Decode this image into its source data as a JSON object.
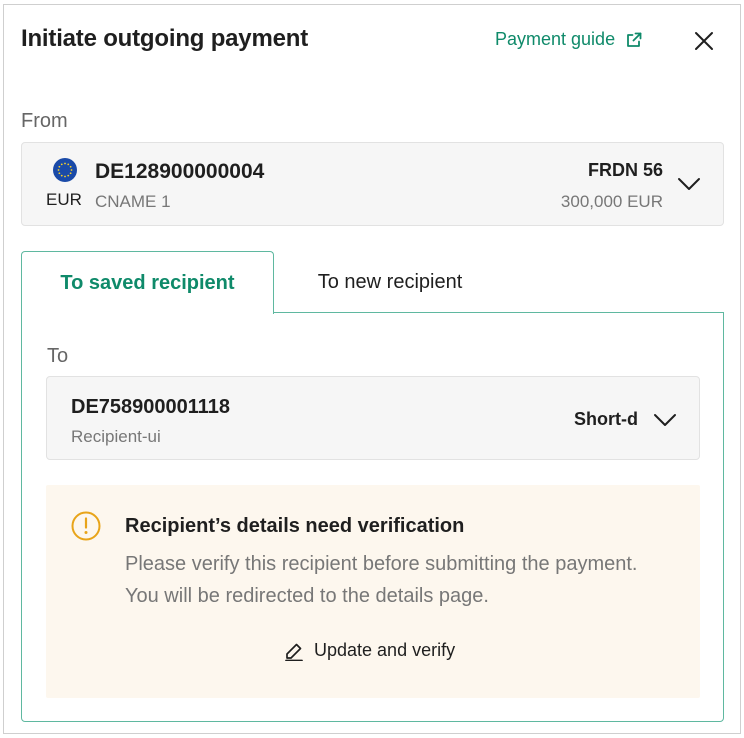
{
  "dialog": {
    "title": "Initiate outgoing payment",
    "guide_link": "Payment guide",
    "close_icon": "close-icon",
    "guide_icon": "external-link-icon"
  },
  "from": {
    "label": "From",
    "currency": "EUR",
    "flag_icon": "eu-flag-icon",
    "account_number": "DE128900000004",
    "account_name": "CNAME 1",
    "account_code": "FRDN 56",
    "balance": "300,000 EUR"
  },
  "tabs": [
    {
      "label": "To saved recipient",
      "active": true
    },
    {
      "label": "To new recipient",
      "active": false
    }
  ],
  "to": {
    "label": "To",
    "account_number": "DE758900001118",
    "recipient_name": "Recipient-ui",
    "reference": "Short-d"
  },
  "notice": {
    "icon": "warning-icon",
    "title": "Recipient’s details need verification",
    "line1": "Please verify this recipient before submitting the payment.",
    "line2": "You will be redirected to the details page.",
    "action_label": "Update and verify",
    "action_icon": "pencil-icon"
  },
  "colors": {
    "accent": "#0f8a6a",
    "tab_border": "#5fb8a0",
    "warning": "#e8a419",
    "notice_bg": "#fdf7ee",
    "flag_blue": "#1a4aa8",
    "flag_star": "#f5d02a"
  }
}
